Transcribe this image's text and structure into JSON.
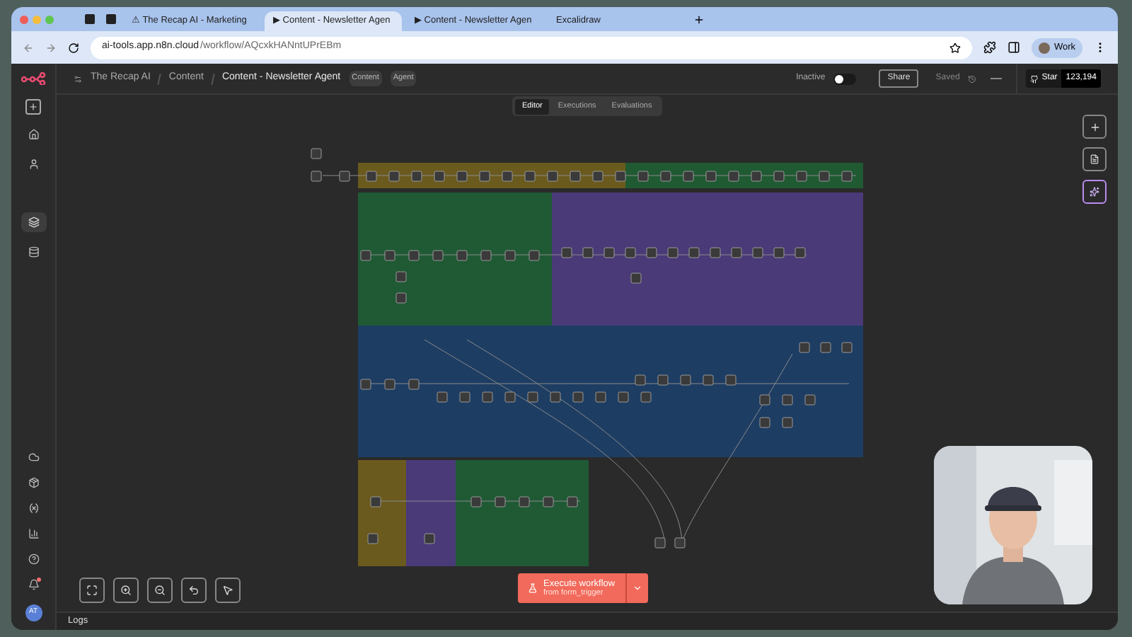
{
  "browser": {
    "tabs": [
      {
        "kind": "icon",
        "selected": false
      },
      {
        "kind": "icon",
        "selected": false
      },
      {
        "kind": "page",
        "title": "⚠ The Recap AI - Marketing",
        "selected": false
      },
      {
        "kind": "page",
        "title": "▶ Content - Newsletter Agen",
        "selected": true
      },
      {
        "kind": "page",
        "title": "▶ Content - Newsletter Agen",
        "selected": false
      },
      {
        "kind": "page",
        "title": "Excalidraw",
        "selected": false
      }
    ],
    "url_host": "ai-tools.app.n8n.cloud",
    "url_path": "/workflow/AQcxkHANntUPrEBm",
    "profile": "Work"
  },
  "header": {
    "breadcrumbs": [
      "The Recap AI",
      "Content"
    ],
    "title": "Content - Newsletter Agent",
    "tags": [
      "Content",
      "Agent"
    ],
    "active_label": "Inactive",
    "active": false,
    "share": "Share",
    "save_state": "Saved",
    "star_label": "Star",
    "star_count": "123,194"
  },
  "view_tabs": [
    {
      "label": "Editor",
      "selected": true
    },
    {
      "label": "Executions",
      "selected": false
    },
    {
      "label": "Evaluations",
      "selected": false
    }
  ],
  "sidebar": {
    "avatar": "AT",
    "notification": true
  },
  "execute": {
    "label": "Execute workflow",
    "sub": "from form_trigger"
  },
  "logs": "Logs"
}
